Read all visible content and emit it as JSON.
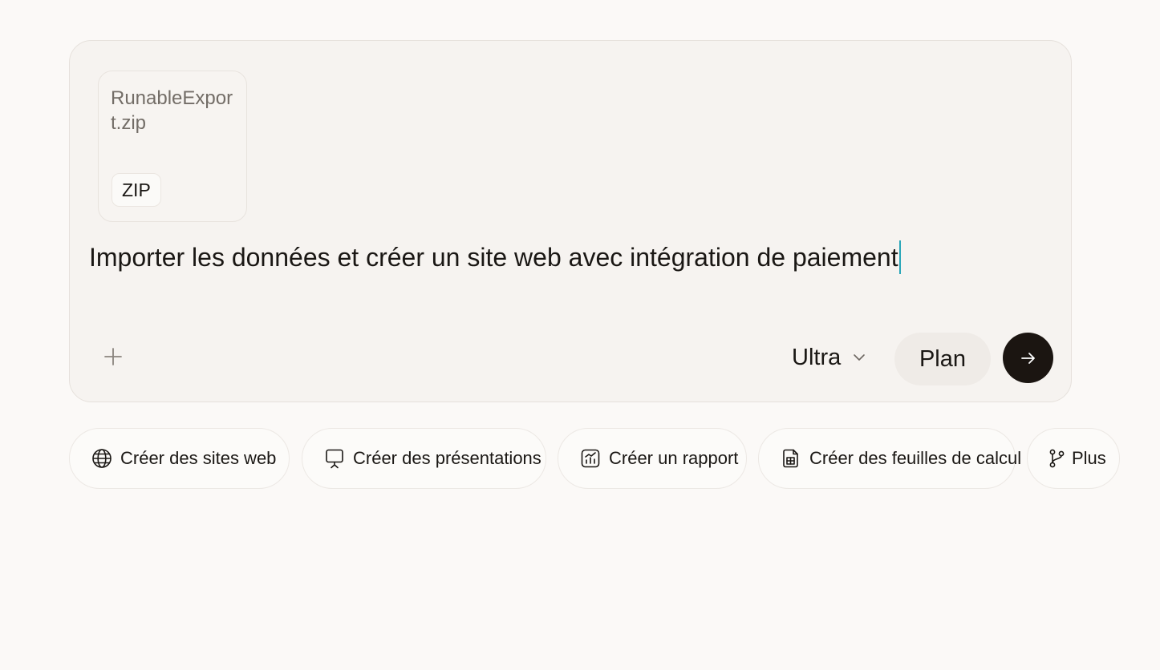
{
  "composer": {
    "attachment": {
      "file_name": "RunableExport.zip",
      "file_type": "ZIP"
    },
    "prompt_text": "Importer les données et créer un site web avec intégration de paiement",
    "add_icon": "plus-icon",
    "model": {
      "label": "Ultra",
      "icon": "chevron-down-icon"
    },
    "plan_label": "Plan",
    "send_icon": "arrow-right-icon"
  },
  "suggestions": [
    {
      "label": "Créer des sites web",
      "icon": "globe-icon"
    },
    {
      "label": "Créer des présentations",
      "icon": "presentation-icon"
    },
    {
      "label": "Créer un rapport",
      "icon": "report-chart-icon"
    },
    {
      "label": "Créer des feuilles de calcul",
      "icon": "spreadsheet-icon"
    },
    {
      "label": "Plus",
      "icon": "git-branch-icon"
    }
  ],
  "colors": {
    "background": "#fbf9f7",
    "send_button": "#1b1511",
    "caret": "#2aa6b9"
  }
}
